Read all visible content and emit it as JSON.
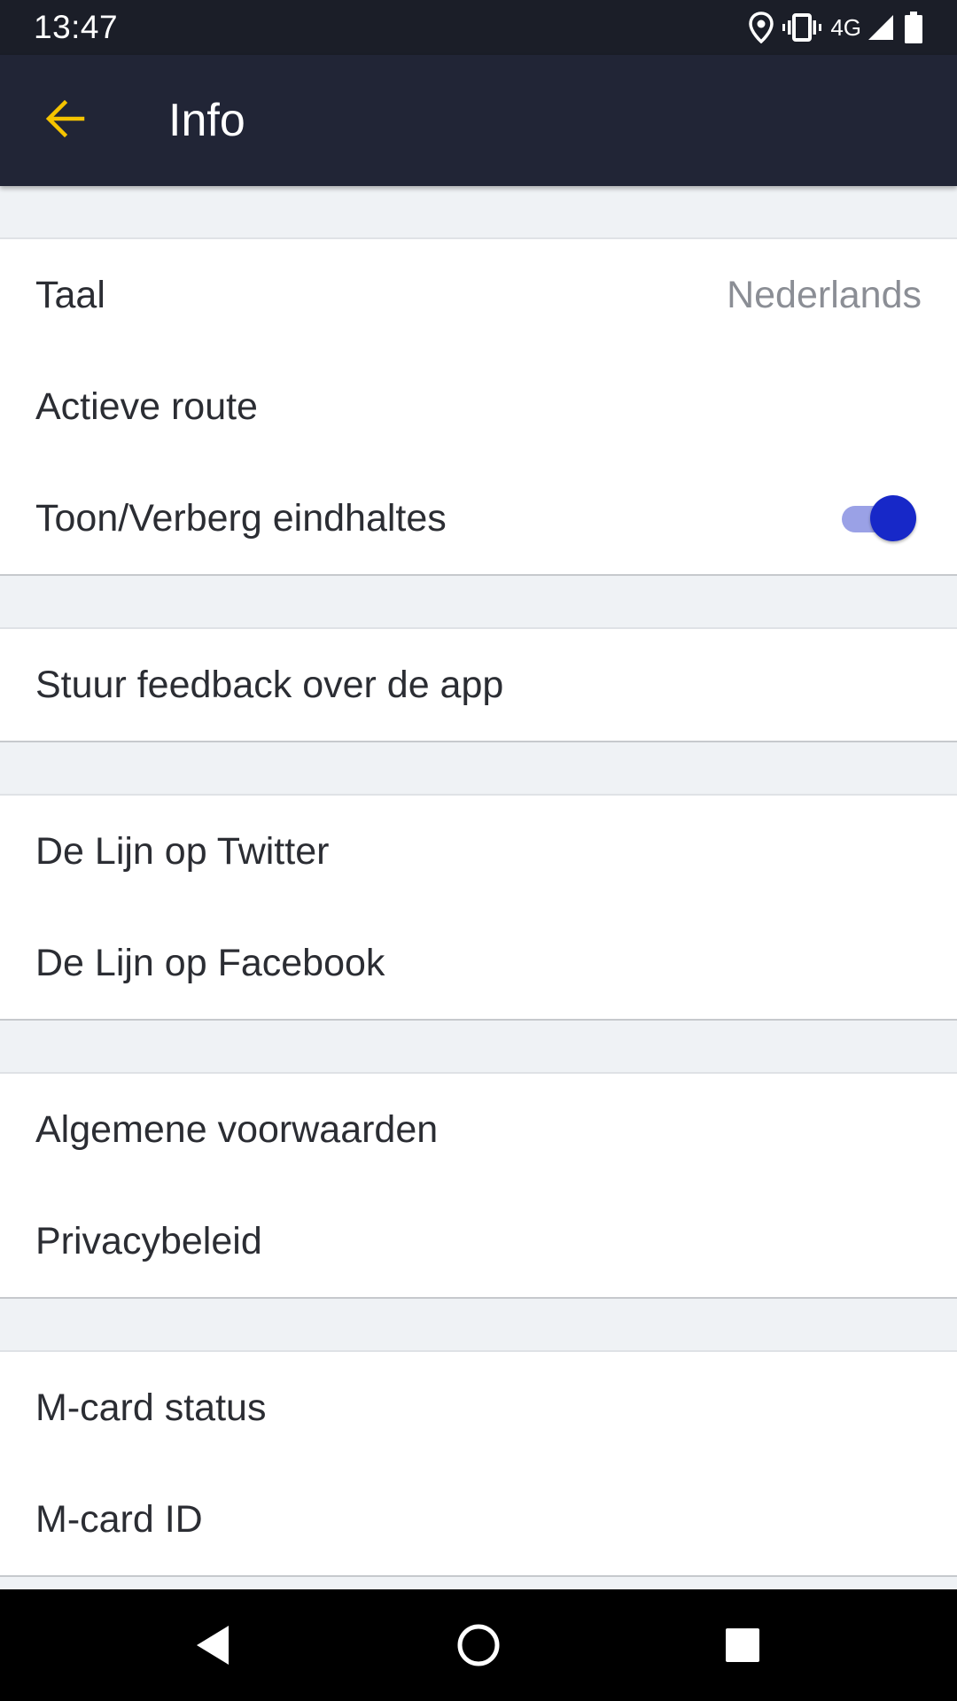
{
  "status_bar": {
    "time": "13:47",
    "network": "4G",
    "icons": [
      "location-icon",
      "vibrate-icon",
      "signal-icon",
      "battery-icon"
    ]
  },
  "app_bar": {
    "title": "Info",
    "back_icon": "arrow-back-icon",
    "accent_color": "#f5c400",
    "background_color": "#212536"
  },
  "sections": [
    {
      "rows": [
        {
          "label": "Taal",
          "value": "Nederlands"
        },
        {
          "label": "Actieve route"
        },
        {
          "label": "Toon/Verberg eindhaltes",
          "toggle": true
        }
      ]
    },
    {
      "rows": [
        {
          "label": "Stuur feedback over de app"
        }
      ]
    },
    {
      "rows": [
        {
          "label": "De Lijn op Twitter"
        },
        {
          "label": "De Lijn op Facebook"
        }
      ]
    },
    {
      "rows": [
        {
          "label": "Algemene voorwaarden"
        },
        {
          "label": "Privacybeleid"
        }
      ]
    },
    {
      "rows": [
        {
          "label": "M-card status"
        },
        {
          "label": "M-card ID"
        }
      ]
    }
  ],
  "toggle_color": "#1728c8",
  "nav_bar": {
    "icons": [
      "back-triangle-icon",
      "home-circle-icon",
      "recents-square-icon"
    ]
  }
}
